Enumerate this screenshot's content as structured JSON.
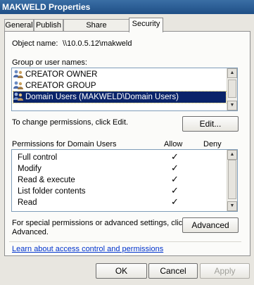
{
  "window": {
    "title": "MAKWELD Properties"
  },
  "tabs": [
    {
      "label": "General"
    },
    {
      "label": "Publish"
    },
    {
      "label": "Share Permissions"
    },
    {
      "label": "Security",
      "active": true
    }
  ],
  "object": {
    "label": "Object name:",
    "value": "\\\\10.0.5.12\\makweld"
  },
  "groups": {
    "label": "Group or user names:",
    "items": [
      {
        "name": "CREATOR OWNER"
      },
      {
        "name": "CREATOR GROUP"
      },
      {
        "name": "Domain Users (MAKWELD\\Domain Users)",
        "selected": true
      }
    ]
  },
  "change": {
    "text": "To change permissions, click Edit.",
    "button": "Edit..."
  },
  "permissions": {
    "header": "Permissions for Domain Users",
    "allow_label": "Allow",
    "deny_label": "Deny",
    "rows": [
      {
        "name": "Full control",
        "allow": "✓",
        "deny": ""
      },
      {
        "name": "Modify",
        "allow": "✓",
        "deny": ""
      },
      {
        "name": "Read & execute",
        "allow": "✓",
        "deny": ""
      },
      {
        "name": "List folder contents",
        "allow": "✓",
        "deny": ""
      },
      {
        "name": "Read",
        "allow": "✓",
        "deny": ""
      }
    ]
  },
  "special": {
    "line1": "For special permissions or advanced settings, click",
    "line2": "Advanced.",
    "button": "Advanced"
  },
  "learn_link": "Learn about access control and permissions",
  "footer": {
    "ok": "OK",
    "cancel": "Cancel",
    "apply": "Apply"
  }
}
